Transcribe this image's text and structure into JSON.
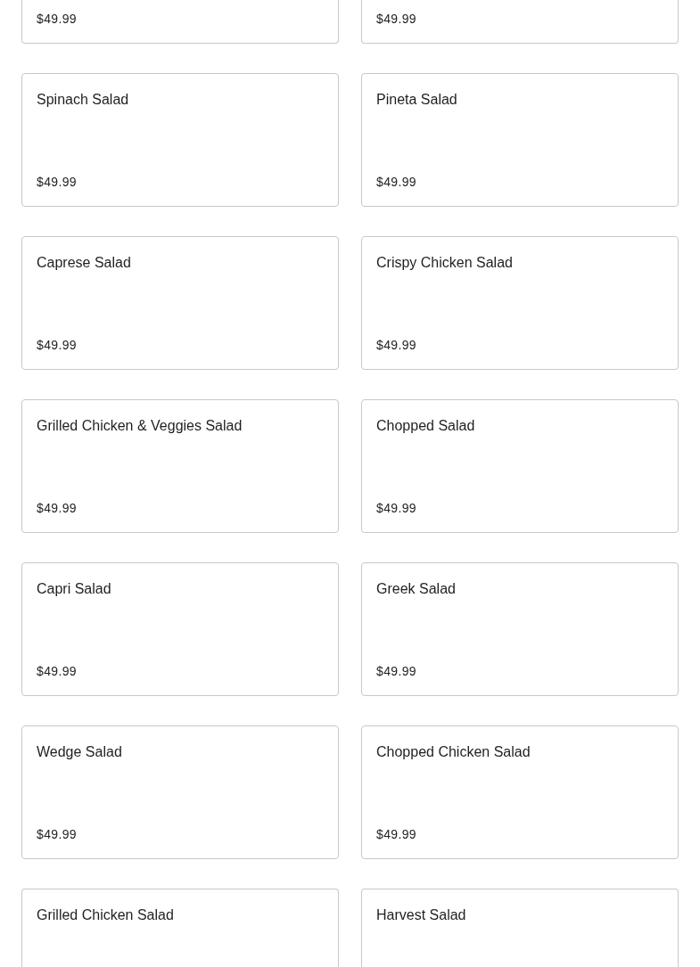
{
  "cards": [
    {
      "price": "$49.99"
    },
    {
      "price": "$49.99"
    },
    {
      "name": "Spinach Salad",
      "price": "$49.99"
    },
    {
      "name": "Pineta Salad",
      "price": "$49.99"
    },
    {
      "name": "Caprese Salad",
      "price": "$49.99"
    },
    {
      "name": "Crispy Chicken Salad",
      "price": "$49.99"
    },
    {
      "name": "Grilled Chicken & Veggies Salad",
      "price": "$49.99"
    },
    {
      "name": "Chopped Salad",
      "price": "$49.99"
    },
    {
      "name": "Capri Salad",
      "price": "$49.99"
    },
    {
      "name": "Greek Salad",
      "price": "$49.99"
    },
    {
      "name": "Wedge Salad",
      "price": "$49.99"
    },
    {
      "name": "Chopped Chicken Salad",
      "price": "$49.99"
    },
    {
      "name": "Grilled Chicken Salad"
    },
    {
      "name": "Harvest Salad"
    }
  ]
}
